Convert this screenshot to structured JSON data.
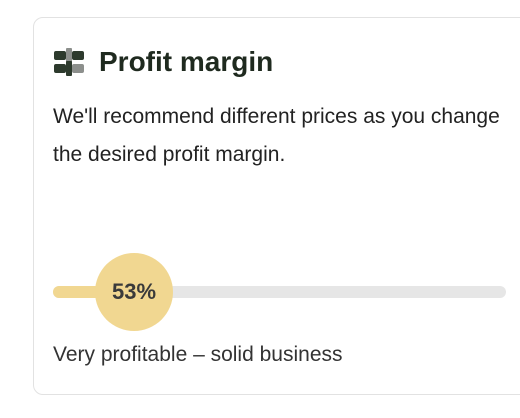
{
  "card": {
    "icon": "sliders-icon",
    "title": "Profit margin",
    "description": "We'll recommend different prices as you change the desired profit margin."
  },
  "slider": {
    "value": 53,
    "value_label": "53%",
    "accent_color": "#f1d791",
    "track_color": "#e6e6e6"
  },
  "status_text": "Very profitable – solid business"
}
